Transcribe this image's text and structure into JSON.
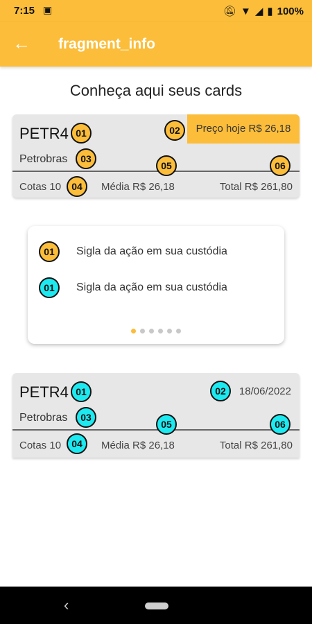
{
  "status_bar": {
    "time": "7:15",
    "sim_icon": "sim-card-icon",
    "battery": "100%"
  },
  "app_bar": {
    "title": "fragment_info",
    "back_icon": "arrow-left-icon"
  },
  "heading": "Conheça aqui seus cards",
  "card_example_1": {
    "ticker": "PETR4",
    "company": "Petrobras",
    "price_label": "Preço hoje R$ 26,18",
    "cotas": "Cotas 10",
    "media": "Média R$ 26,18",
    "total": "Total R$ 261,80",
    "badge_color": "#fbbd3a",
    "badges": [
      "01",
      "02",
      "03",
      "04",
      "05",
      "06"
    ]
  },
  "info_panel": {
    "items": [
      {
        "badge": "01",
        "badge_color": "#fbbd3a",
        "text": "Sigla da ação em sua custódia"
      },
      {
        "badge": "01",
        "badge_color": "#1de9f0",
        "text": "Sigla da ação em sua custódia"
      }
    ],
    "pager": {
      "total": 6,
      "active": 1
    }
  },
  "card_example_2": {
    "ticker": "PETR4",
    "company": "Petrobras",
    "date": "18/06/2022",
    "cotas": "Cotas 10",
    "media": "Média R$ 26,18",
    "total": "Total R$ 261,80",
    "badge_color": "#1de9f0",
    "badges": [
      "01",
      "02",
      "03",
      "04",
      "05",
      "06"
    ]
  },
  "colors": {
    "accent": "#fbbd3a",
    "cyan": "#1de9f0",
    "card_bg": "#e7e7e7"
  }
}
